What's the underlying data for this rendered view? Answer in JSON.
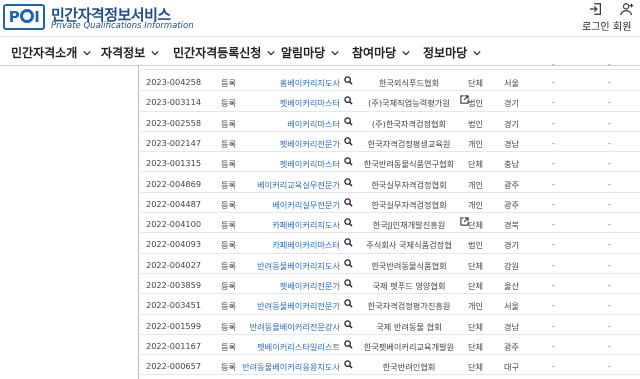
{
  "header": {
    "logo_text": "PQI",
    "title": "민간자격정보서비스",
    "subtitle": "Private Qualifications Information",
    "login_label": "로그인",
    "join_label": "회원가"
  },
  "nav": [
    {
      "label": "민간자격소개"
    },
    {
      "label": "자격정보"
    },
    {
      "label": "민간자격등록신청"
    },
    {
      "label": "알림마당"
    },
    {
      "label": "참여마당"
    },
    {
      "label": "정보마당"
    }
  ],
  "top_row": {
    "d1": "-",
    "d2": "-"
  },
  "rows": [
    {
      "no": "2023-004258",
      "type": "등록",
      "name": "홈베이커리지도사",
      "org": "한국외식푸드협회",
      "external": false,
      "kind": "단체",
      "region": "서울",
      "d1": "-",
      "d2": "-"
    },
    {
      "no": "2023-003114",
      "type": "등록",
      "name": "펫베이커리마스터",
      "org": "(주)국제직업능력평가원",
      "external": true,
      "kind": "법인",
      "region": "경기",
      "d1": "-",
      "d2": "-"
    },
    {
      "no": "2023-002558",
      "type": "등록",
      "name": "베이커리마스터",
      "org": "(주)한국자격검정협회",
      "external": false,
      "kind": "법인",
      "region": "경기",
      "d1": "-",
      "d2": "-"
    },
    {
      "no": "2023-002147",
      "type": "등록",
      "name": "펫베이커리전문가",
      "org": "한국자격검정평생교육원",
      "external": false,
      "kind": "개인",
      "region": "경남",
      "d1": "-",
      "d2": "-"
    },
    {
      "no": "2023-001315",
      "type": "등록",
      "name": "펫베이커리마스터",
      "org": "한국반려동물식품연구협회",
      "external": false,
      "kind": "단체",
      "region": "충남",
      "d1": "-",
      "d2": "-"
    },
    {
      "no": "2022-004869",
      "type": "등록",
      "name": "베이커리교육실무전문가",
      "org": "한국실무자격검정협회",
      "external": false,
      "kind": "개인",
      "region": "광주",
      "d1": "-",
      "d2": "-"
    },
    {
      "no": "2022-004487",
      "type": "등록",
      "name": "베이커리실무전문가",
      "org": "한국실무자격검정협회",
      "external": false,
      "kind": "개인",
      "region": "광주",
      "d1": "-",
      "d2": "-"
    },
    {
      "no": "2022-004100",
      "type": "등록",
      "name": "카페베이커리지도사",
      "org": "한국JJ인재개발진흥원",
      "external": true,
      "kind": "단체",
      "region": "경북",
      "d1": "-",
      "d2": "-"
    },
    {
      "no": "2022-004093",
      "type": "등록",
      "name": "카페베이커리마스터",
      "org": "주식회사 국제식품검정협",
      "external": false,
      "kind": "법인",
      "region": "경기",
      "d1": "-",
      "d2": "-"
    },
    {
      "no": "2022-004027",
      "type": "등록",
      "name": "반려동물베이커리지도사",
      "org": "한국반려동물식품협회",
      "external": false,
      "kind": "단체",
      "region": "강원",
      "d1": "-",
      "d2": "-"
    },
    {
      "no": "2022-003859",
      "type": "등록",
      "name": "펫베이커리전문가",
      "org": "국제 펫푸드 영양협회",
      "external": false,
      "kind": "단체",
      "region": "울산",
      "d1": "-",
      "d2": "-"
    },
    {
      "no": "2022-003451",
      "type": "등록",
      "name": "반려동물베이커리전문가",
      "org": "한국자격검정평가진흥원",
      "external": false,
      "kind": "개인",
      "region": "서울",
      "d1": "-",
      "d2": "-"
    },
    {
      "no": "2022-001599",
      "type": "등록",
      "name": "반려동물베이커리전문강사",
      "org": "국제 반려동물 협회",
      "external": false,
      "kind": "단체",
      "region": "경남",
      "d1": "-",
      "d2": "-"
    },
    {
      "no": "2022-001167",
      "type": "등록",
      "name": "펫베이커리스타일리스트",
      "org": "한국펫베이커리교육개발원",
      "external": false,
      "kind": "단체",
      "region": "광주",
      "d1": "-",
      "d2": "-"
    },
    {
      "no": "2022-000657",
      "type": "등록",
      "name": "반려동물베이커리응용지도사",
      "org": "한국반려인협회",
      "external": false,
      "kind": "단체",
      "region": "대구",
      "d1": "-",
      "d2": "-"
    }
  ]
}
